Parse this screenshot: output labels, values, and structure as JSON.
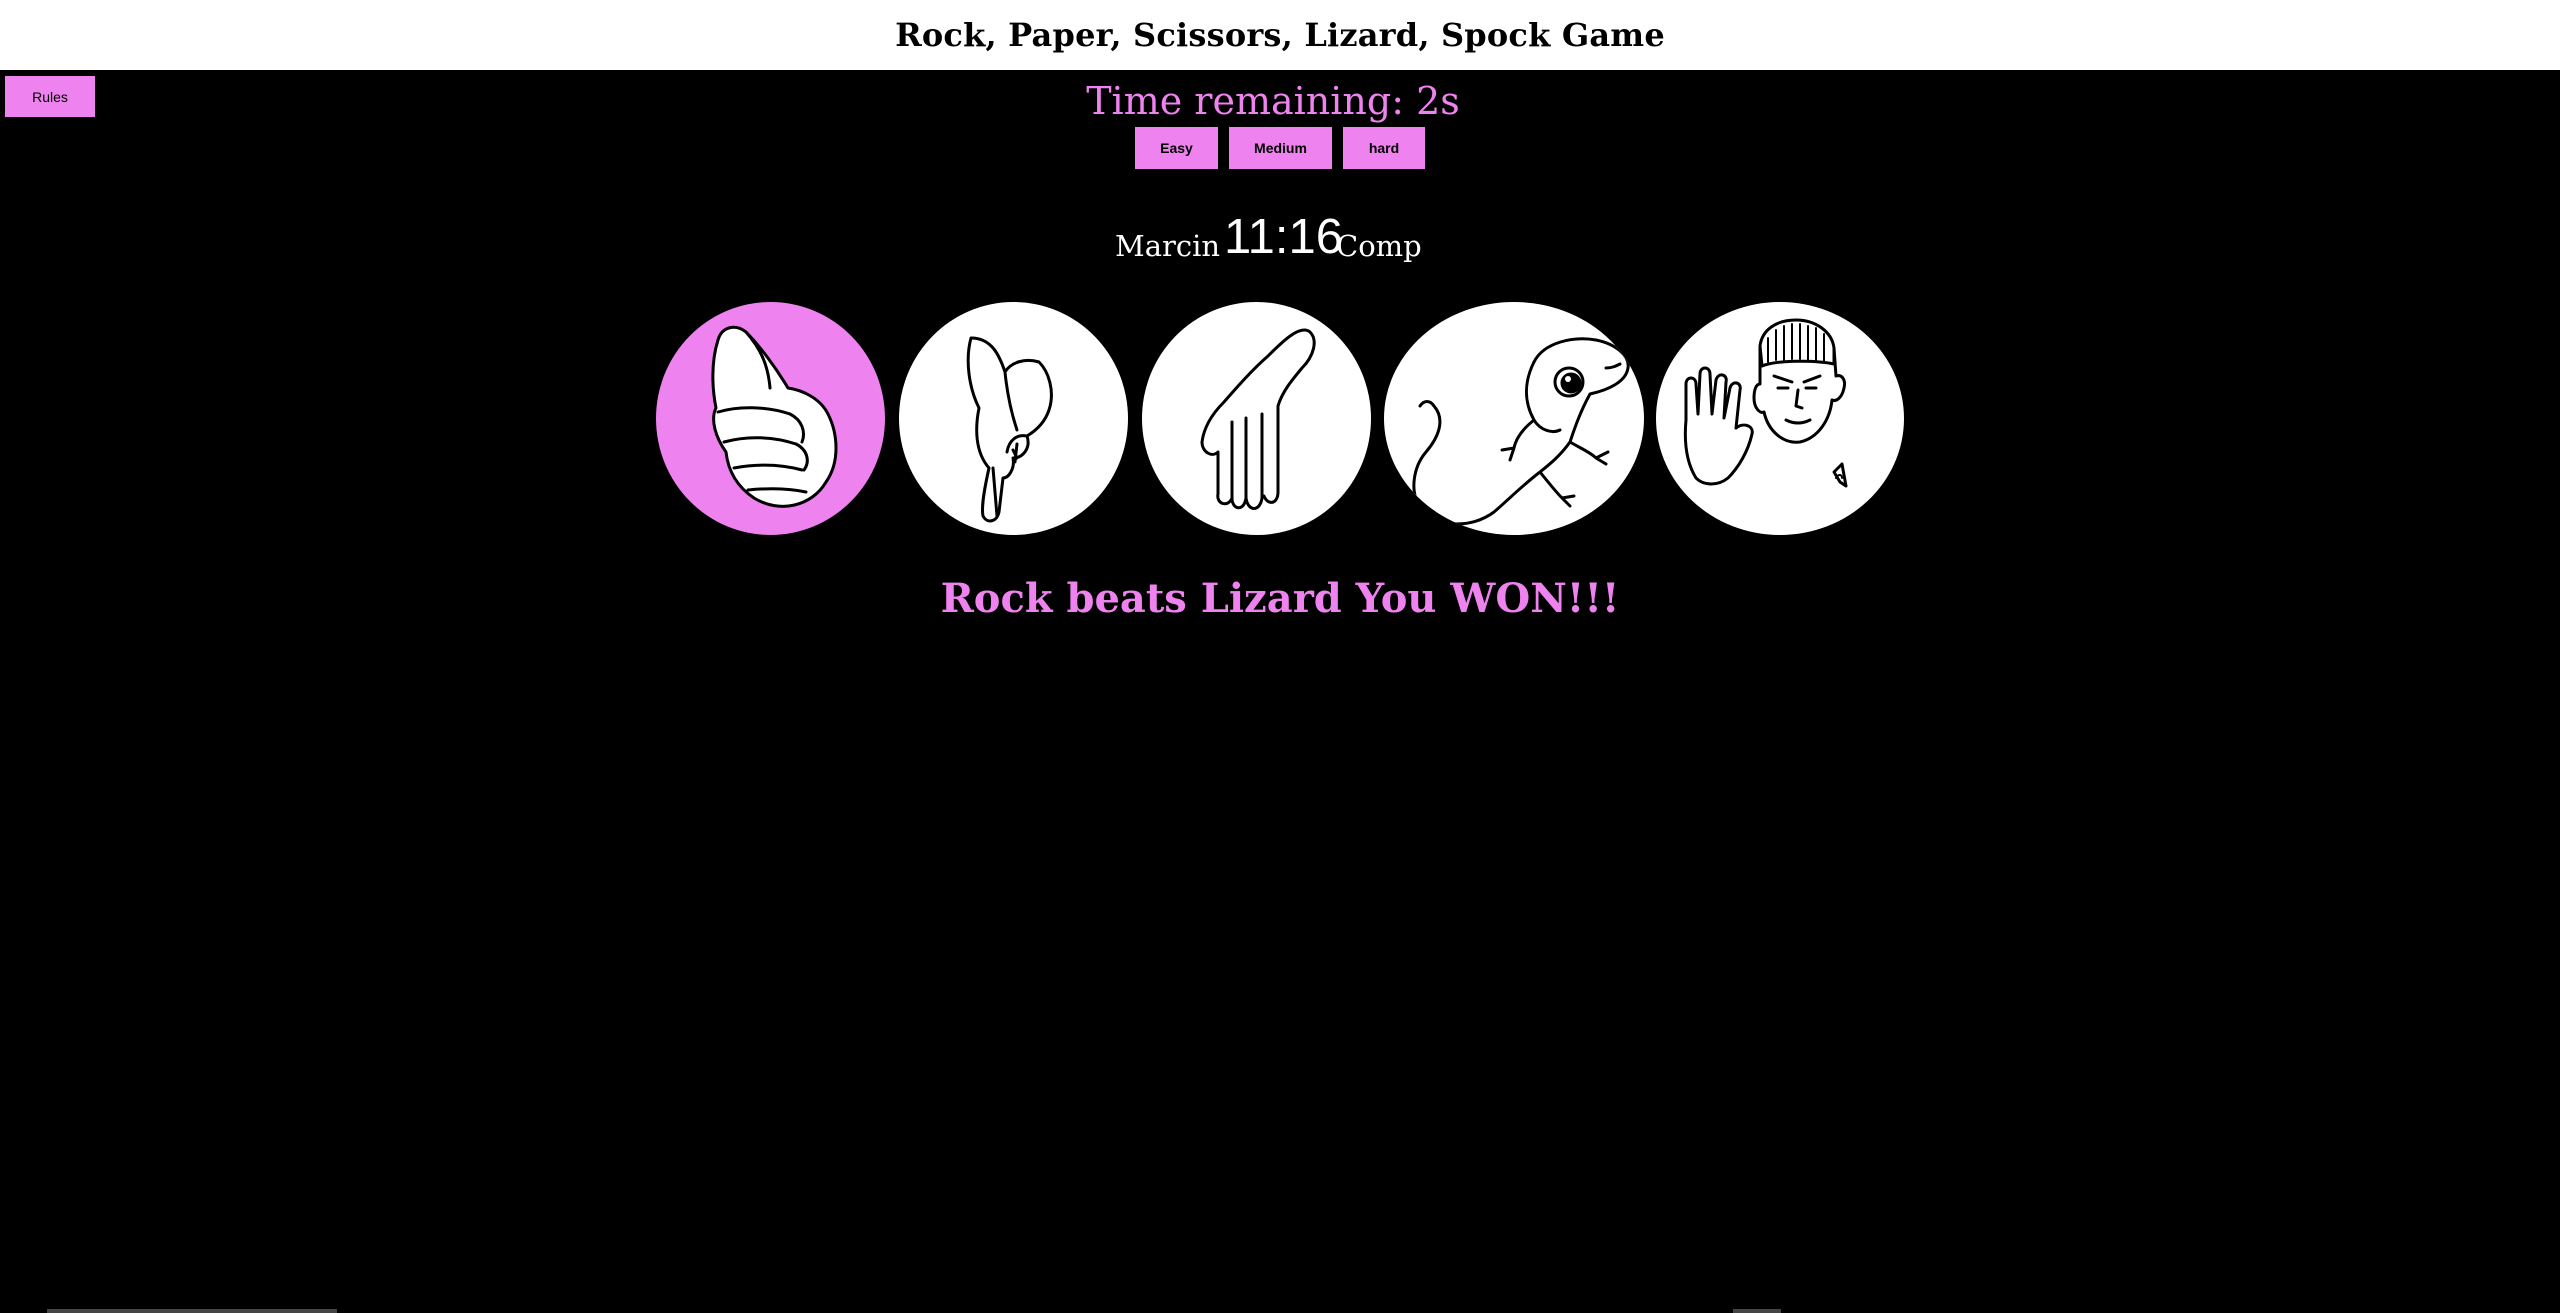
{
  "header": {
    "title": "Rock, Paper, Scissors, Lizard, Spock Game"
  },
  "rules_button": {
    "label": "Rules"
  },
  "timer": {
    "text": "Time remaining: 2s"
  },
  "difficulty": {
    "easy_label": "Easy",
    "medium_label": "Medium",
    "hard_label": "hard"
  },
  "scoreboard": {
    "player_name": "Marcin",
    "score": "11:16",
    "opponent_name": "Comp"
  },
  "choices": [
    {
      "id": "rock",
      "icon": "rock-fist-icon",
      "selected": true
    },
    {
      "id": "scissors",
      "icon": "scissors-hand-icon",
      "selected": false
    },
    {
      "id": "paper",
      "icon": "paper-hand-icon",
      "selected": false
    },
    {
      "id": "lizard",
      "icon": "lizard-icon",
      "selected": false
    },
    {
      "id": "spock",
      "icon": "spock-icon",
      "selected": false
    }
  ],
  "result": {
    "message": "Rock beats Lizard You WON!!!"
  },
  "colors": {
    "accent": "#ee82ee",
    "background": "#000000",
    "header_bg": "#ffffff"
  }
}
